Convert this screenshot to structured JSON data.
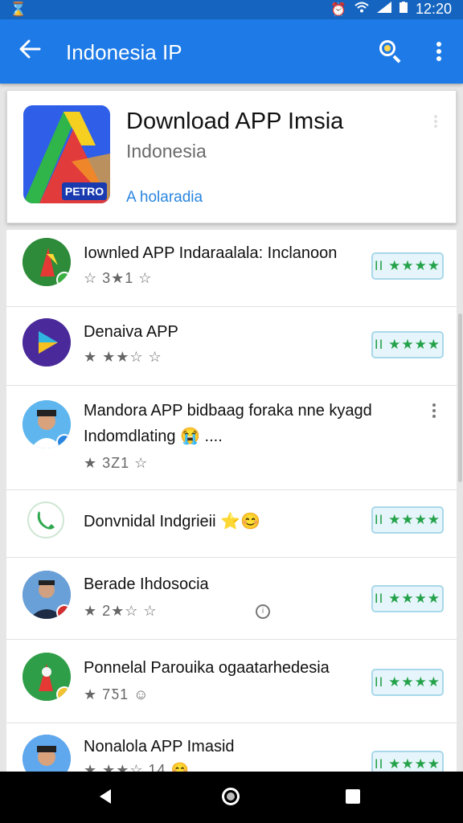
{
  "status_bar": {
    "left_icon": "hourglass-notification-icon",
    "time": "12:20",
    "icons": [
      "alarm-icon",
      "wifi-icon",
      "signal-icon",
      "battery-icon"
    ]
  },
  "app_bar": {
    "title": "Indonesia IP",
    "back_icon": "arrow-back-icon",
    "search_icon": "search-icon",
    "more_icon": "more-vert-icon",
    "color": "#1e7ae6"
  },
  "header": {
    "app_title": "Download APP Imsia",
    "app_subtitle": "Indonesia",
    "link": "A holaradia",
    "icon_badge": "PETRO"
  },
  "list": {
    "rows": [
      {
        "title": "Iownled APP Indaraalala: Inclanoon",
        "rating": "☆ 3★1 ☆",
        "stars": "II ★★★★",
        "avatar_color": "#2e8b3a",
        "status_color": "#3cb043"
      },
      {
        "title": "Denaiva APP",
        "rating": "★ ★★☆ ☆",
        "stars": "II ★★★★",
        "avatar_color": "#4a2a9a",
        "status_color": ""
      },
      {
        "title": "Mandora APP bidbaag foraka nne kyagd",
        "title2": "Indomdlating 😭 ....",
        "rating": "★ 3Z1 ☆",
        "stars": "",
        "avatar_color": "#2a9be0",
        "status_color": "#2a86e0"
      },
      {
        "title": "Donvnidal Indgrieii ⭐😊",
        "rating": "",
        "stars": "II ★★★★",
        "avatar_color": "#ffffff",
        "status_color": ""
      },
      {
        "title": "Berade Ihdosocia",
        "rating": "★ 2★☆ ☆",
        "stars": "II ★★★★",
        "avatar_color": "#3d6fb0",
        "status_color": "#d32f2f"
      },
      {
        "title": "Ponnelal Parouika ogaatarhedesia",
        "rating": "★ 7Ƽ1 ☺",
        "stars": "II ★★★★",
        "avatar_color": "#2f9e48",
        "status_color": "#f2c230"
      },
      {
        "title": "Nonalola APP Imasid",
        "rating": "★ ★★☆ 14 😊",
        "stars": "II ★★★★",
        "avatar_color": "#2a7ee0",
        "status_color": ""
      }
    ]
  },
  "nav_bar": {
    "back_icon": "nav-back-icon",
    "home_icon": "nav-home-icon",
    "recents_icon": "nav-recents-icon"
  }
}
